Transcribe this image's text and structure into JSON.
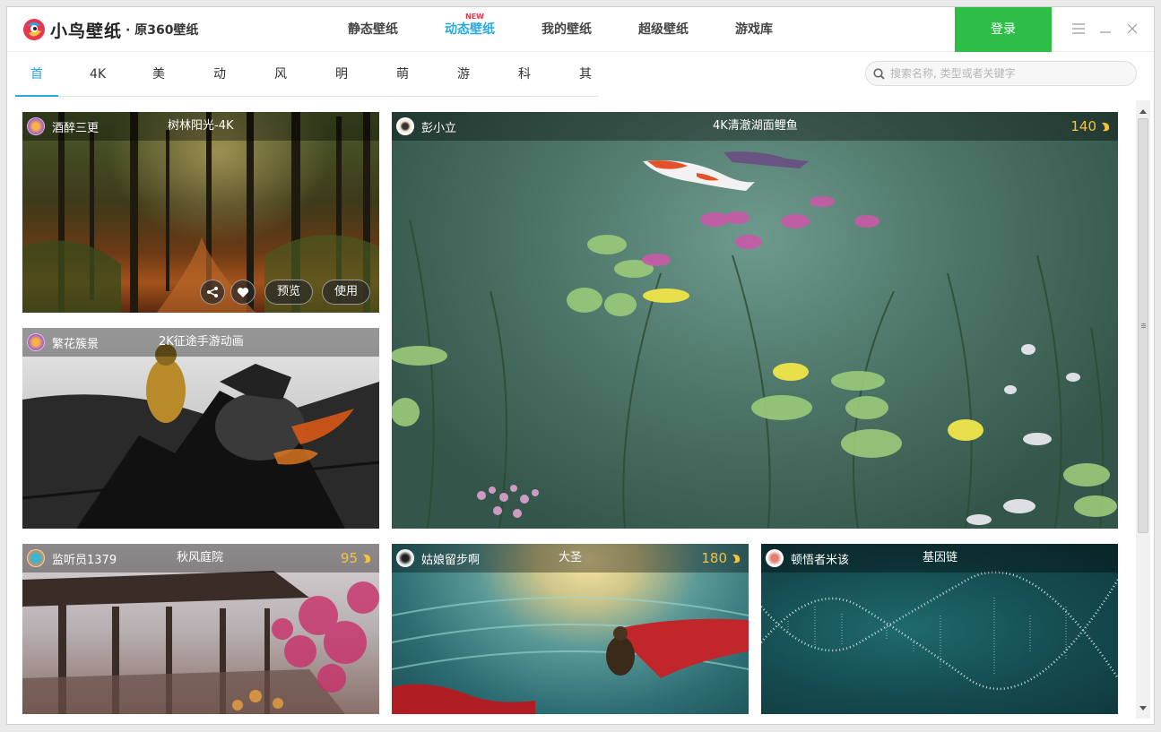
{
  "app": {
    "logo_text": "小鸟壁纸",
    "logo_sub": "· 原360壁纸",
    "login_label": "登录"
  },
  "topnav": {
    "items": [
      {
        "label": "静态壁纸"
      },
      {
        "label": "动态壁纸",
        "badge": "NEW"
      },
      {
        "label": "我的壁纸"
      },
      {
        "label": "超级壁纸"
      },
      {
        "label": "游戏库"
      }
    ],
    "active_index": 1
  },
  "categories": {
    "items": [
      "首页",
      "4K",
      "美女",
      "动漫",
      "风景",
      "明星",
      "萌宠",
      "游戏",
      "科技",
      "其他"
    ],
    "active_index": 0
  },
  "search": {
    "placeholder": "搜索名称, 类型或者关键字"
  },
  "cards": [
    {
      "author": "酒醉三更",
      "title": "树林阳光-4K",
      "price": "",
      "actions": {
        "preview": "预览",
        "use": "使用"
      }
    },
    {
      "author": "繁花簇景",
      "title": "2K征途手游动画",
      "price": ""
    },
    {
      "author": "彭小立",
      "title": "4K清澈湖面鲤鱼",
      "price": "140"
    },
    {
      "author": "监听员1379",
      "title": "秋风庭院",
      "price": "95"
    },
    {
      "author": "姑娘留步啊",
      "title": "大圣",
      "price": "180"
    },
    {
      "author": "顿悟者米该",
      "title": "基因链",
      "price": ""
    }
  ],
  "colors": {
    "accent": "#29a7e1",
    "login_green": "#2ebd46",
    "price_gold": "#f5c23b",
    "new_badge": "#e8384f"
  }
}
